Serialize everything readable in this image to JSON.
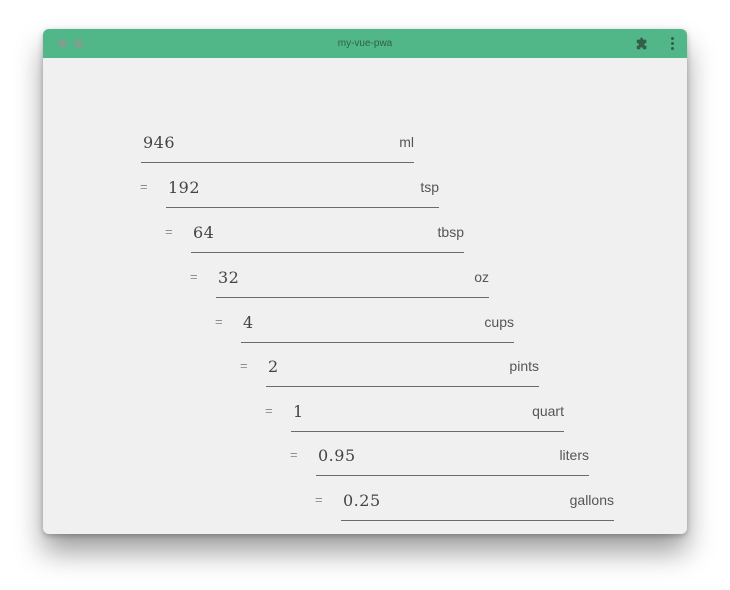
{
  "window": {
    "title": "my-vue-pwa",
    "accent_color": "#52b788",
    "extension_icon": "puzzle-icon",
    "menu_icon": "kebab-menu-icon"
  },
  "converter": {
    "equals_sign": "=",
    "rows": [
      {
        "value": "946",
        "unit": "ml"
      },
      {
        "value": "192",
        "unit": "tsp"
      },
      {
        "value": "64",
        "unit": "tbsp"
      },
      {
        "value": "32",
        "unit": "oz"
      },
      {
        "value": "4",
        "unit": "cups"
      },
      {
        "value": "2",
        "unit": "pints"
      },
      {
        "value": "1",
        "unit": "quart"
      },
      {
        "value": "0.95",
        "unit": "liters"
      },
      {
        "value": "0.25",
        "unit": "gallons"
      }
    ]
  }
}
